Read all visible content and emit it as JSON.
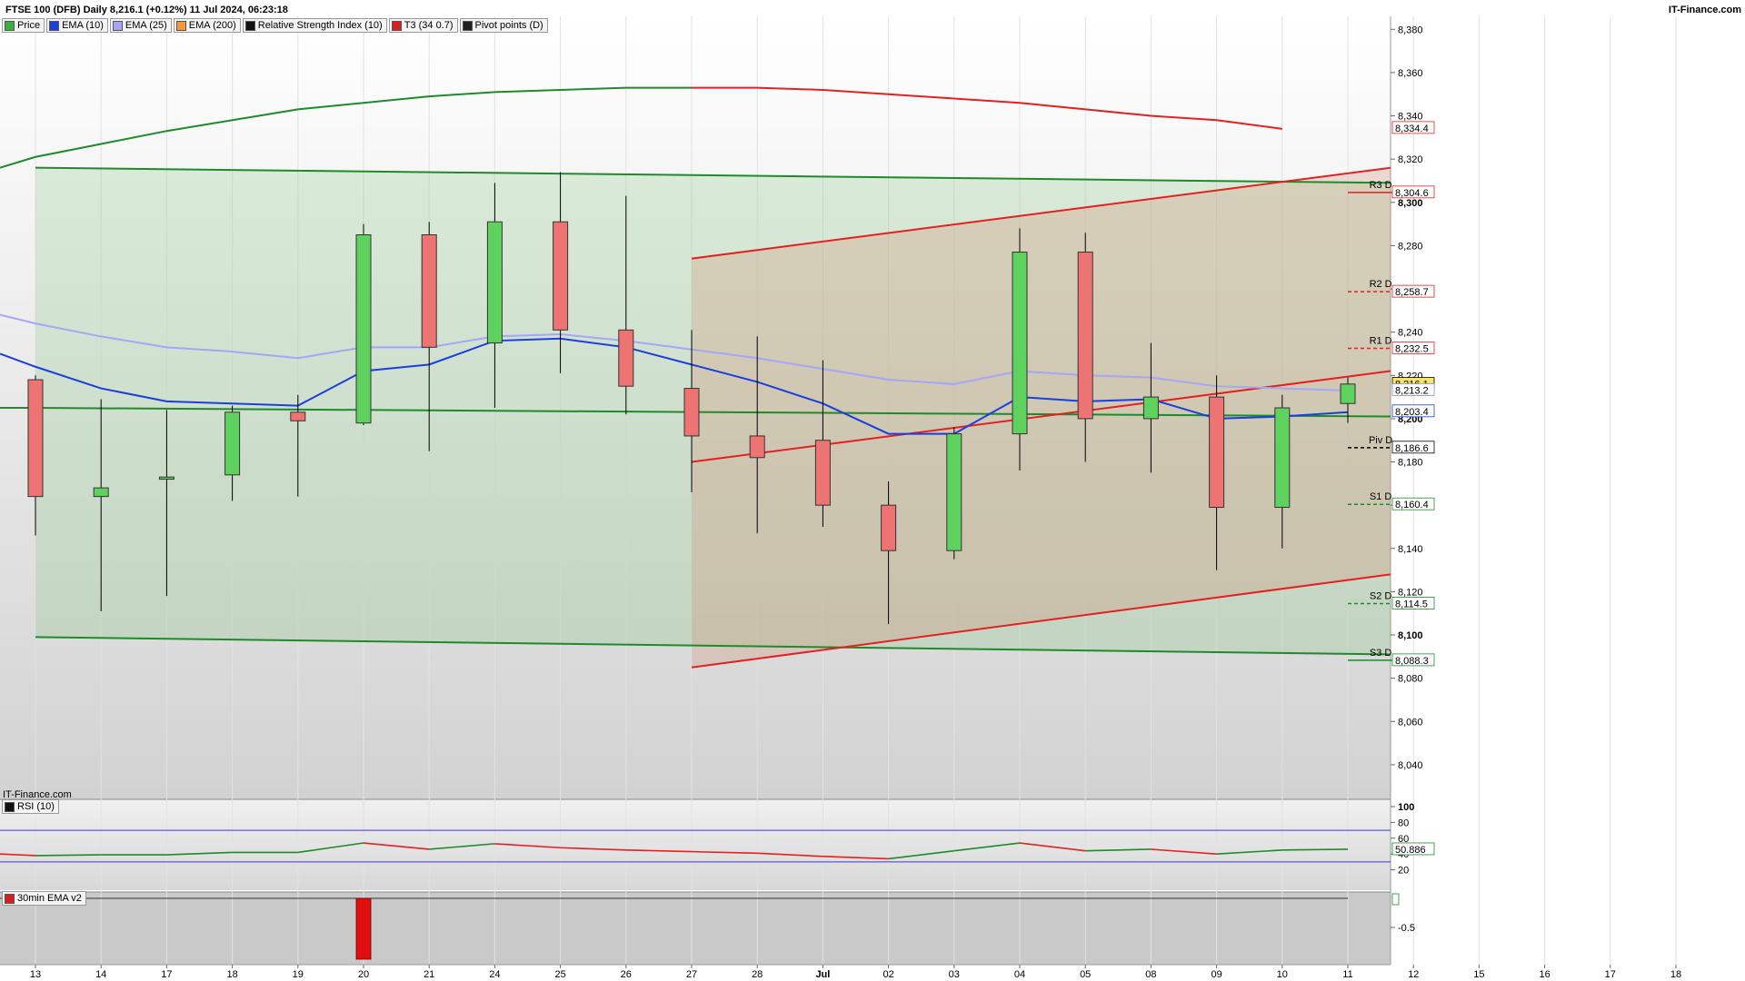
{
  "header": {
    "title": "FTSE 100 (DFB) Daily 8,216.1 (+0.12%) 11 Jul 2024, 06:23:18",
    "brand": "IT-Finance.com",
    "watermark": "IT-Finance.com"
  },
  "legend": [
    {
      "label": "Price",
      "color": "#3cb043"
    },
    {
      "label": "EMA (10)",
      "color": "#1a3fdc"
    },
    {
      "label": "EMA (25)",
      "color": "#a5a6f5"
    },
    {
      "label": "EMA (200)",
      "color": "#f39a3a"
    },
    {
      "label": "Relative Strength Index (10)",
      "color": "#111111"
    },
    {
      "label": "T3 (34 0.7)",
      "color": "#d42020"
    },
    {
      "label": "Pivot points (D)",
      "color": "#222222"
    }
  ],
  "rsi_legend": "RSI (10)",
  "ema30_legend": "30min EMA v2",
  "colors": {
    "up": "#5fd15f",
    "down": "#ee7373",
    "ema10": "#1a3fdc",
    "ema25": "#a5a6f5",
    "channel_green": "#1f8a2a",
    "channel_red": "#e42020"
  },
  "chart_data": {
    "type": "candlestick",
    "x_tick_labels": [
      "13",
      "14",
      "17",
      "18",
      "19",
      "20",
      "21",
      "24",
      "25",
      "26",
      "27",
      "28",
      "Jul",
      "02",
      "03",
      "04",
      "05",
      "08",
      "09",
      "10",
      "11",
      "12",
      "15",
      "16",
      "17",
      "18"
    ],
    "y_ticks": [
      "8,380",
      "8,360",
      "8,340",
      "8,320",
      "8,300",
      "8,280",
      "8,260",
      "8,240",
      "8,220",
      "8,200",
      "8,180",
      "8,160",
      "8,140",
      "8,120",
      "8,100",
      "8,080",
      "8,060",
      "8,040"
    ],
    "ylim": [
      8024,
      8386
    ],
    "candles": [
      {
        "o": 8218,
        "h": 8220,
        "l": 8146,
        "c": 8164
      },
      {
        "o": 8164,
        "h": 8209,
        "l": 8111,
        "c": 8168
      },
      {
        "o": 8172,
        "h": 8204,
        "l": 8118,
        "c": 8173
      },
      {
        "o": 8174,
        "h": 8206,
        "l": 8162,
        "c": 8203
      },
      {
        "o": 8203,
        "h": 8211,
        "l": 8164,
        "c": 8199
      },
      {
        "o": 8198,
        "h": 8290,
        "l": 8197,
        "c": 8285
      },
      {
        "o": 8285,
        "h": 8291,
        "l": 8185,
        "c": 8233
      },
      {
        "o": 8235,
        "h": 8309,
        "l": 8205,
        "c": 8291
      },
      {
        "o": 8291,
        "h": 8314,
        "l": 8221,
        "c": 8241
      },
      {
        "o": 8241,
        "h": 8303,
        "l": 8202,
        "c": 8215
      },
      {
        "o": 8214,
        "h": 8241,
        "l": 8166,
        "c": 8192
      },
      {
        "o": 8192,
        "h": 8238,
        "l": 8147,
        "c": 8182
      },
      {
        "o": 8190,
        "h": 8227,
        "l": 8150,
        "c": 8160
      },
      {
        "o": 8160,
        "h": 8171,
        "l": 8105,
        "c": 8139
      },
      {
        "o": 8139,
        "h": 8196,
        "l": 8135,
        "c": 8193
      },
      {
        "o": 8193,
        "h": 8288,
        "l": 8176,
        "c": 8277
      },
      {
        "o": 8277,
        "h": 8286,
        "l": 8180,
        "c": 8200
      },
      {
        "o": 8200,
        "h": 8235,
        "l": 8175,
        "c": 8210
      },
      {
        "o": 8210,
        "h": 8220,
        "l": 8130,
        "c": 8159
      },
      {
        "o": 8159,
        "h": 8211,
        "l": 8140,
        "c": 8205
      },
      {
        "o": 8207,
        "h": 8219,
        "l": 8198,
        "c": 8216
      }
    ],
    "ema10": [
      8230,
      8224,
      8214,
      8208,
      8207,
      8206,
      8222,
      8225,
      8236,
      8237,
      8233,
      8225,
      8217,
      8207,
      8193,
      8193,
      8210,
      8208,
      8209,
      8200,
      8201,
      8203
    ],
    "ema25": [
      8248,
      8244,
      8238,
      8233,
      8231,
      8228,
      8233,
      8233,
      8238,
      8239,
      8236,
      8232,
      8228,
      8223,
      8218,
      8216,
      8222,
      8220,
      8219,
      8215,
      8214,
      8213
    ],
    "t3": {
      "green_to_index": 11,
      "values": [
        8316,
        8321,
        8327,
        8333,
        8338,
        8343,
        8346,
        8349,
        8351,
        8352,
        8353,
        8353,
        8353,
        8352,
        8350,
        8348,
        8346,
        8343,
        8340,
        8338,
        8334
      ]
    },
    "channel_green": {
      "upper": [
        8316,
        8309
      ],
      "mid": [
        8205,
        8201
      ],
      "lower": [
        8099,
        8091
      ]
    },
    "channel_red": {
      "upper": [
        8274,
        8316
      ],
      "mid": [
        8180,
        8222
      ],
      "lower": [
        8085,
        8128
      ]
    },
    "pivots": [
      {
        "label": "R3 D",
        "value": 8304.6,
        "color": "#e42020",
        "dashed": false
      },
      {
        "label": "R2 D",
        "value": 8258.7,
        "color": "#e42020",
        "dashed": true
      },
      {
        "label": "R1 D",
        "value": 8232.5,
        "color": "#e42020",
        "dashed": true
      },
      {
        "label": "Piv D",
        "value": 8186.6,
        "color": "#000000",
        "dashed": true
      },
      {
        "label": "S1 D",
        "value": 8160.4,
        "color": "#1f8a2a",
        "dashed": true
      },
      {
        "label": "S2 D",
        "value": 8114.5,
        "color": "#1f8a2a",
        "dashed": true
      },
      {
        "label": "S3 D",
        "value": 8088.3,
        "color": "#1f8a2a",
        "dashed": false
      }
    ],
    "price_tags": [
      {
        "text": "8,334.4",
        "value": 8334.4,
        "color": "#e42020",
        "bg": "#ffffff"
      },
      {
        "text": "8,304.6",
        "value": 8304.6,
        "color": "#e42020",
        "bg": "#ffffff"
      },
      {
        "text": "8,258.7",
        "value": 8258.7,
        "color": "#e42020",
        "bg": "#ffffff"
      },
      {
        "text": "8,232.5",
        "value": 8232.5,
        "color": "#e42020",
        "bg": "#ffffff"
      },
      {
        "text": "8,216.1",
        "value": 8216.1,
        "color": "#000000",
        "bg": "#f7e36a"
      },
      {
        "text": "8,213.2",
        "value": 8213.2,
        "color": "#8a8ad8",
        "bg": "#ffffff"
      },
      {
        "text": "8,203.4",
        "value": 8203.4,
        "color": "#1a3fdc",
        "bg": "#ffffff"
      },
      {
        "text": "8,186.6",
        "value": 8186.6,
        "color": "#000000",
        "bg": "#ffffff"
      },
      {
        "text": "8,160.4",
        "value": 8160.4,
        "color": "#1f8a2a",
        "bg": "#ffffff"
      },
      {
        "text": "8,114.5",
        "value": 8114.5,
        "color": "#1f8a2a",
        "bg": "#ffffff"
      },
      {
        "text": "8,088.3",
        "value": 8088.3,
        "color": "#1f8a2a",
        "bg": "#ffffff"
      }
    ],
    "rsi": {
      "ticks": [
        "100",
        "80",
        "60",
        "40",
        "20"
      ],
      "values": [
        40,
        38,
        39,
        39,
        42,
        42,
        54,
        46,
        53,
        48,
        45,
        43,
        41,
        37,
        34,
        44,
        54,
        44,
        46,
        40,
        45,
        46
      ],
      "last_label": "50.886",
      "upper": 70,
      "lower": 30
    },
    "ema30": {
      "tick": "-0.5",
      "bar_index": 5
    }
  }
}
